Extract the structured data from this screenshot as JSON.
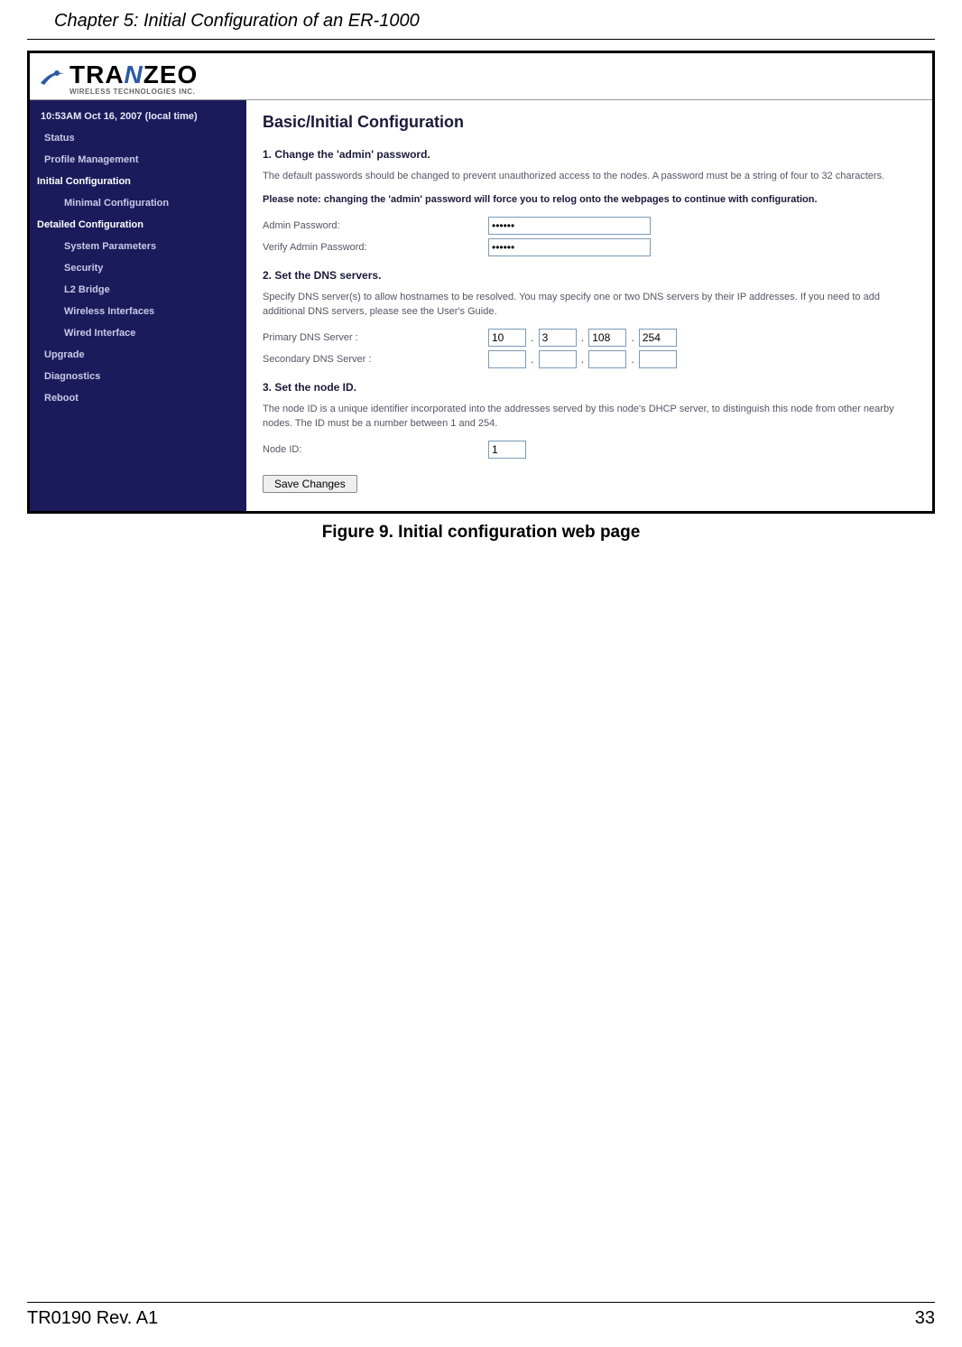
{
  "page": {
    "header": "Chapter 5: Initial Configuration of an ER-1000",
    "footer_left": "TR0190 Rev. A1",
    "footer_right": "33",
    "caption": "Figure 9. Initial configuration web page"
  },
  "brand": {
    "pre": "TRA",
    "mid": "N",
    "post": "ZEO",
    "sub": "WIRELESS  TECHNOLOGIES INC."
  },
  "sidebar": {
    "time": "10:53AM Oct 16, 2007 (local time)",
    "status": "Status",
    "profile": "Profile Management",
    "initial": "Initial Configuration",
    "minimal": "Minimal Configuration",
    "detailed": "Detailed Configuration",
    "sysparams": "System Parameters",
    "security": "Security",
    "l2bridge": "L2 Bridge",
    "wireless": "Wireless Interfaces",
    "wired": "Wired Interface",
    "upgrade": "Upgrade",
    "diagnostics": "Diagnostics",
    "reboot": "Reboot"
  },
  "main": {
    "title": "Basic/Initial Configuration",
    "s1_heading": "1. Change the 'admin' password.",
    "s1_p1": "The default passwords should be changed to prevent unauthorized access to the nodes. A password must be a string of four to 32 characters.",
    "s1_note": "Please note: changing the 'admin' password will force you to relog onto the webpages to continue with configuration.",
    "admin_pw_label": "Admin Password:",
    "admin_pw_value": "••••••",
    "verify_pw_label": "Verify Admin Password:",
    "verify_pw_value": "••••••",
    "s2_heading": "2. Set the DNS servers.",
    "s2_p1": "Specify DNS server(s) to allow hostnames to be resolved. You may specify one or two DNS servers by their IP addresses. If you need to add additional DNS servers, please see the User's Guide.",
    "primary_dns_label": "Primary DNS Server :",
    "secondary_dns_label": "Secondary DNS Server :",
    "dns": {
      "p1": "10",
      "p2": "3",
      "p3": "108",
      "p4": "254",
      "s1": "",
      "s2": "",
      "s3": "",
      "s4": ""
    },
    "s3_heading": "3. Set the node ID.",
    "s3_p1": "The node ID is a unique identifier incorporated into the addresses served by this node's DHCP server, to distinguish this node from other nearby nodes. The ID must be a number between 1 and 254.",
    "node_id_label": "Node ID:",
    "node_id_value": "1",
    "save_label": "Save Changes"
  }
}
